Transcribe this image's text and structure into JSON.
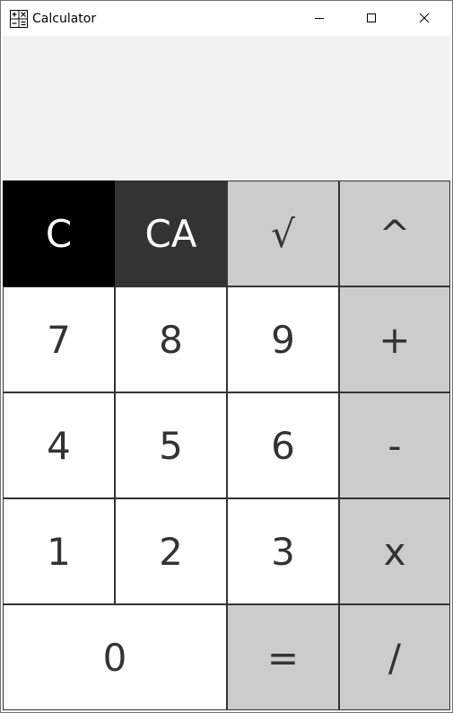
{
  "window": {
    "title": "Calculator",
    "icon": "calculator-icon",
    "controls": {
      "minimize_icon": "minimize-icon",
      "maximize_icon": "maximize-icon",
      "close_icon": "close-icon"
    }
  },
  "display": {
    "value": ""
  },
  "keys": {
    "clear": "C",
    "clear_all": "CA",
    "sqrt": "√",
    "power": "^",
    "seven": "7",
    "eight": "8",
    "nine": "9",
    "plus": "+",
    "four": "4",
    "five": "5",
    "six": "6",
    "minus": "-",
    "one": "1",
    "two": "2",
    "three": "3",
    "multiply": "x",
    "zero": "0",
    "equals": "=",
    "divide": "/"
  },
  "colors": {
    "display_bg": "#f2f2f2",
    "number_key_bg": "#ffffff",
    "operator_key_bg": "#cccccc",
    "clear_key_bg": "#000000",
    "clear_all_key_bg": "#333333",
    "key_text": "#333333",
    "key_border": "#333333"
  }
}
